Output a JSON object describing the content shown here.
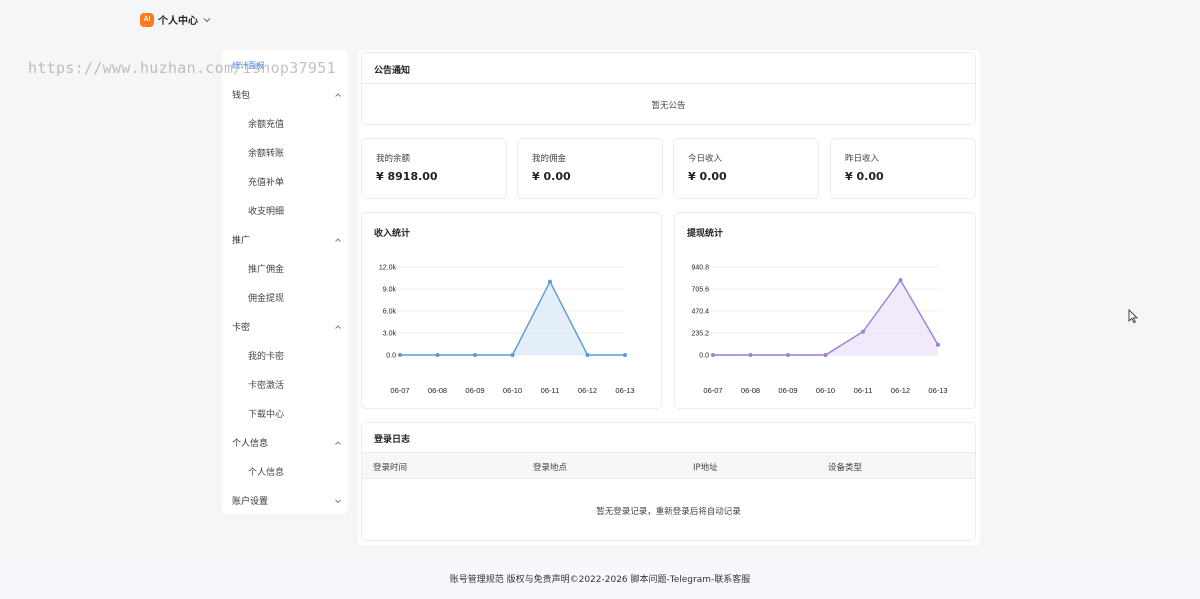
{
  "header": {
    "logo_text": "AI",
    "title": "个人中心"
  },
  "watermark": "https://www.huzhan.com/ishop37951",
  "sidebar": {
    "active_label": "统计面板",
    "groups": [
      {
        "label": "钱包",
        "items": [
          "余额充值",
          "余额转账",
          "充值补单",
          "收支明细"
        ]
      },
      {
        "label": "推广",
        "items": [
          "推广佣金",
          "佣金提现"
        ]
      },
      {
        "label": "卡密",
        "items": [
          "我的卡密",
          "卡密激活",
          "下载中心"
        ]
      },
      {
        "label": "个人信息",
        "items": [
          "个人信息"
        ]
      },
      {
        "label": "账户设置",
        "items": []
      }
    ]
  },
  "notice": {
    "title": "公告通知",
    "empty_text": "暂无公告"
  },
  "stats": [
    {
      "label": "我的余额",
      "value": "¥ 8918.00"
    },
    {
      "label": "我的佣金",
      "value": "¥ 0.00"
    },
    {
      "label": "今日收入",
      "value": "¥ 0.00"
    },
    {
      "label": "昨日收入",
      "value": "¥ 0.00"
    }
  ],
  "chart_data": [
    {
      "type": "area",
      "title": "收入统计",
      "categories": [
        "06-07",
        "06-08",
        "06-09",
        "06-10",
        "06-11",
        "06-12",
        "06-13"
      ],
      "values": [
        0,
        0,
        0,
        0,
        10000,
        0,
        0
      ],
      "y_ticks": [
        "0.0",
        "3.0k",
        "6.0k",
        "9.0k",
        "12.0k"
      ],
      "ylim": [
        0,
        12000
      ],
      "color": "#5b9bd5",
      "fill": "#dbe9f7",
      "grid": true
    },
    {
      "type": "area",
      "title": "提现统计",
      "categories": [
        "06-07",
        "06-08",
        "06-09",
        "06-10",
        "06-11",
        "06-12",
        "06-13"
      ],
      "values": [
        0,
        0,
        0,
        0,
        250,
        800,
        110
      ],
      "y_ticks": [
        "0.0",
        "235.2",
        "470.4",
        "705.6",
        "940.8"
      ],
      "ylim": [
        0,
        940.8
      ],
      "color": "#9b7fd9",
      "fill": "#ebe3f8",
      "grid": true
    }
  ],
  "login_log": {
    "title": "登录日志",
    "columns": [
      "登录时间",
      "登录地点",
      "IP地址",
      "设备类型"
    ],
    "empty_text": "暂无登录记录，重新登录后将自动记录"
  },
  "footer": {
    "text": "账号管理规范 版权与免责声明©2022-2026 脚本问题-Telegram-联系客服"
  }
}
